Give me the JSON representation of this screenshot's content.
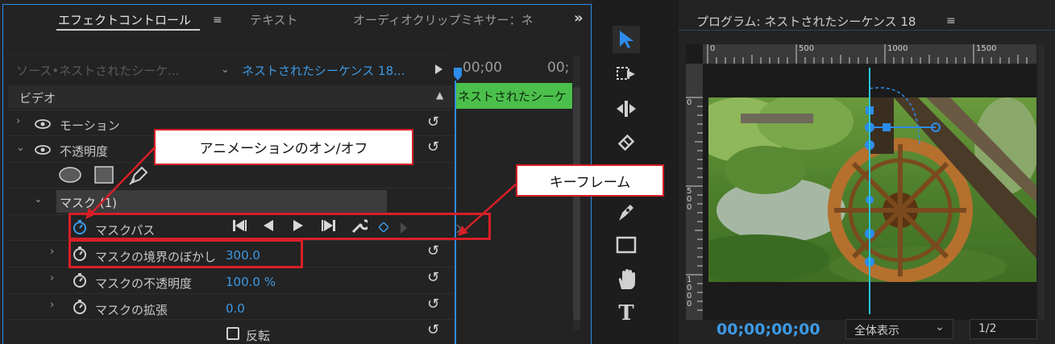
{
  "effect_controls": {
    "tabs": [
      "エフェクトコントロール",
      "テキスト",
      "オーディオクリップミキサー：ネ"
    ],
    "menu_icon": "≡",
    "overflow": "»",
    "source_label": "ソース•ネストされたシーケ...",
    "sequence_label": "ネストされたシーケンス 18...",
    "timecode_start": "00;00",
    "timecode_end": "00;",
    "clip_label": "ネストされたシーケ",
    "section_video": "ビデオ",
    "rows": {
      "motion": "モーション",
      "opacity": "不透明度",
      "mask": "マスク (1)",
      "mask_path": "マスクパス",
      "mask_feather": "マスクの境界のぼかし",
      "mask_feather_value": "300.0",
      "mask_opacity": "マスクの不透明度",
      "mask_opacity_value": "100.0 %",
      "mask_expansion": "マスクの拡張",
      "mask_expansion_value": "0.0",
      "inverted": "反転"
    }
  },
  "annotations": {
    "animation_toggle": "アニメーションのオン/オフ",
    "keyframe": "キーフレーム"
  },
  "program_monitor": {
    "title": "プログラム: ネストされたシーケンス 18",
    "menu_icon": "≡",
    "ruler_top": [
      "0",
      "500",
      "1000",
      "1500"
    ],
    "ruler_left": [
      "0",
      "500",
      "1000"
    ],
    "timecode": "00;00;00;00",
    "zoom": "全体表示",
    "resolution": "1/2"
  },
  "colors": {
    "accent_blue": "#2d8ceb",
    "value_blue": "#3c9ae6",
    "clip_green": "#4bbf4b",
    "annotation_red": "#d81f26",
    "playhead_cyan": "#27c5dc"
  }
}
